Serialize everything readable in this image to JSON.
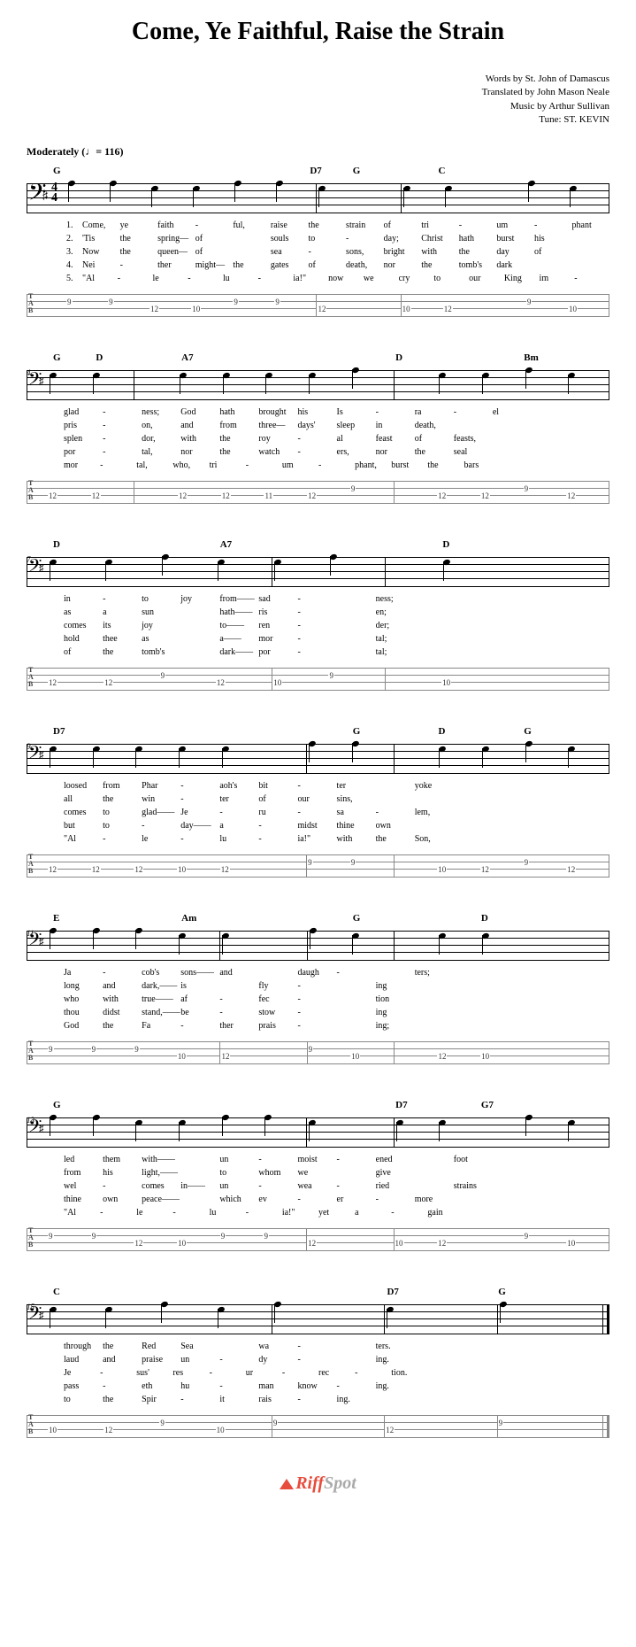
{
  "title": "Come, Ye Faithful, Raise the Strain",
  "credits": {
    "line1": "Words by St. John of Damascus",
    "line2": "Translated by John Mason Neale",
    "line3": "Music by Arthur Sullivan",
    "line4": "Tune: ST. KEVIN"
  },
  "tempo": "Moderately  (♩= 116)",
  "timesig_top": "4",
  "timesig_bot": "4",
  "clef": "𝄢",
  "sharp": "♯",
  "tab_label": "T\nA\nB",
  "watermark": {
    "a": "Riff",
    "b": "Spot"
  },
  "systems": [
    {
      "barnum": "",
      "first": true,
      "chords": [
        "G",
        "",
        "",
        "",
        "",
        "",
        "D7",
        "G",
        "",
        "C",
        "",
        "",
        ""
      ],
      "tab": [
        [
          "2",
          "9"
        ],
        [
          "2",
          "9"
        ],
        [
          "3",
          "12"
        ],
        [
          "3",
          "10"
        ],
        [
          "2",
          "9"
        ],
        [
          "2",
          "9"
        ],
        [
          "3",
          "12"
        ],
        [
          "",
          "B"
        ],
        [
          "3",
          "10"
        ],
        [
          "3",
          "12"
        ],
        [
          "",
          "B"
        ],
        [
          "2",
          "9"
        ],
        [
          "3",
          "10"
        ]
      ],
      "bars": [
        6,
        8,
        13
      ],
      "verses": [
        [
          "1.",
          "Come,",
          "ye",
          "faith",
          "-",
          "ful,",
          "raise",
          "the",
          "strain",
          "of",
          "tri",
          "-",
          "um",
          "-",
          "phant"
        ],
        [
          "2.",
          "'Tis",
          "the",
          "spring—",
          "of",
          "",
          "souls",
          "to",
          "-",
          "day;",
          "Christ",
          "hath",
          "burst",
          "his",
          ""
        ],
        [
          "3.",
          "Now",
          "the",
          "queen—",
          "of",
          "",
          "sea",
          "-",
          "sons,",
          "bright",
          "with",
          "the",
          "day",
          "of",
          ""
        ],
        [
          "4.",
          "Nei",
          "-",
          "ther",
          "might—",
          "the",
          "gates",
          "of",
          "death,",
          "nor",
          "the",
          "tomb's",
          "dark",
          "",
          ""
        ],
        [
          "5.",
          "\"Al",
          "-",
          "le",
          "-",
          "lu",
          "-",
          "ia!\"",
          "now",
          "we",
          "cry",
          "to",
          "our",
          "King",
          "im",
          "-"
        ]
      ]
    },
    {
      "barnum": "4",
      "chords": [
        "G",
        "D",
        "",
        "A7",
        "",
        "",
        "",
        "",
        "D",
        "",
        "",
        "Bm",
        ""
      ],
      "tab": [
        [
          "3",
          "12"
        ],
        [
          "3",
          "12"
        ],
        [
          "",
          "B"
        ],
        [
          "3",
          "12"
        ],
        [
          "3",
          "12"
        ],
        [
          "3",
          "11"
        ],
        [
          "3",
          "12"
        ],
        [
          "2",
          "9"
        ],
        [
          "",
          "B"
        ],
        [
          "3",
          "12"
        ],
        [
          "3",
          "12"
        ],
        [
          "2",
          "9"
        ],
        [
          "3",
          "12"
        ]
      ],
      "bars": [
        2,
        8,
        13
      ],
      "verses": [
        [
          "",
          "glad",
          "-",
          "ness;",
          "God",
          "hath",
          "brought",
          "his",
          "Is",
          "-",
          "ra",
          "-",
          "el",
          "",
          ""
        ],
        [
          "",
          "pris",
          "-",
          "on,",
          "and",
          "from",
          "three—",
          "days'",
          "sleep",
          "in",
          "death,",
          "",
          "",
          "",
          ""
        ],
        [
          "",
          "splen",
          "-",
          "dor,",
          "with",
          "the",
          "roy",
          "-",
          "al",
          "feast",
          "of",
          "feasts,",
          "",
          "",
          ""
        ],
        [
          "",
          "por",
          "-",
          "tal,",
          "nor",
          "the",
          "watch",
          "-",
          "ers,",
          "nor",
          "the",
          "seal",
          "",
          "",
          ""
        ],
        [
          "",
          "mor",
          "-",
          "tal,",
          "who,",
          "tri",
          "-",
          "um",
          "-",
          "phant,",
          "burst",
          "the",
          "bars",
          "",
          "",
          ""
        ]
      ]
    },
    {
      "barnum": "7",
      "chords": [
        "D",
        "",
        "",
        "A7",
        "",
        "",
        "",
        "D",
        "",
        ""
      ],
      "tab": [
        [
          "3",
          "12"
        ],
        [
          "3",
          "12"
        ],
        [
          "2",
          "9"
        ],
        [
          "3",
          "12"
        ],
        [
          "3",
          "10"
        ],
        [
          "2",
          "9"
        ],
        [
          "",
          "B"
        ],
        [
          "3",
          "10"
        ],
        [
          "",
          "B"
        ],
        [
          "",
          "B"
        ]
      ],
      "bars": [
        4,
        6,
        10
      ],
      "verses": [
        [
          "",
          "in",
          "-",
          "to",
          "joy",
          "from——",
          "sad",
          "-",
          "",
          "ness;",
          "",
          "",
          "",
          "",
          ""
        ],
        [
          "",
          "as",
          "a",
          "sun",
          "",
          "hath——",
          "ris",
          "-",
          "",
          "en;",
          "",
          "",
          "",
          "",
          ""
        ],
        [
          "",
          "comes",
          "its",
          "joy",
          "",
          "to——",
          "ren",
          "-",
          "",
          "der;",
          "",
          "",
          "",
          "",
          ""
        ],
        [
          "",
          "hold",
          "thee",
          "as",
          "",
          "a——",
          "mor",
          "-",
          "",
          "tal;",
          "",
          "",
          "",
          "",
          ""
        ],
        [
          "",
          "of",
          "the",
          "tomb's",
          "",
          "dark——",
          "por",
          "-",
          "",
          "tal;",
          "",
          "",
          "",
          "",
          ""
        ]
      ]
    },
    {
      "barnum": "9",
      "chords": [
        "D7",
        "",
        "",
        "",
        "",
        "",
        "",
        "G",
        "",
        "D",
        "",
        "G",
        ""
      ],
      "tab": [
        [
          "3",
          "12"
        ],
        [
          "3",
          "12"
        ],
        [
          "3",
          "12"
        ],
        [
          "3",
          "10"
        ],
        [
          "3",
          "12"
        ],
        [
          "",
          "B"
        ],
        [
          "2",
          "9"
        ],
        [
          "2",
          "9"
        ],
        [
          "",
          "B"
        ],
        [
          "3",
          "10"
        ],
        [
          "3",
          "12"
        ],
        [
          "2",
          "9"
        ],
        [
          "3",
          "12"
        ]
      ],
      "bars": [
        6,
        8,
        13
      ],
      "verses": [
        [
          "",
          "loosed",
          "from",
          "Phar",
          "-",
          "aoh's",
          "bit",
          "-",
          "ter",
          "",
          "yoke",
          "",
          "",
          "",
          ""
        ],
        [
          "",
          "all",
          "the",
          "win",
          "-",
          "ter",
          "of",
          "our",
          "sins,",
          "",
          "",
          "",
          "",
          "",
          ""
        ],
        [
          "",
          "comes",
          "to",
          "glad——",
          "Je",
          "-",
          "ru",
          "-",
          "sa",
          "-",
          "lem,",
          "",
          "",
          "",
          ""
        ],
        [
          "",
          "but",
          "to",
          "-",
          "day——",
          "a",
          "-",
          "midst",
          "thine",
          "own",
          "",
          "",
          "",
          "",
          ""
        ],
        [
          "",
          "\"Al",
          "-",
          "le",
          "-",
          "lu",
          "-",
          "ia!\"",
          "with",
          "the",
          "Son,",
          "",
          "",
          "",
          ""
        ]
      ]
    },
    {
      "barnum": "11",
      "chords": [
        "E",
        "",
        "",
        "Am",
        "",
        "",
        "",
        "G",
        "",
        "",
        "D",
        "",
        ""
      ],
      "tab": [
        [
          "2",
          "9"
        ],
        [
          "2",
          "9"
        ],
        [
          "2",
          "9"
        ],
        [
          "3",
          "10"
        ],
        [
          "3",
          "12"
        ],
        [
          "",
          "B"
        ],
        [
          "2",
          "9"
        ],
        [
          "3",
          "10"
        ],
        [
          "",
          "B"
        ],
        [
          "3",
          "12"
        ],
        [
          "3",
          "10"
        ],
        [
          "",
          "B"
        ],
        [
          "",
          "B"
        ]
      ],
      "bars": [
        4,
        6,
        8,
        13
      ],
      "verses": [
        [
          "",
          "Ja",
          "-",
          "cob's",
          "sons——",
          "and",
          "",
          "daugh",
          "-",
          "",
          "ters;",
          "",
          "",
          "",
          ""
        ],
        [
          "",
          "long",
          "and",
          "dark,——",
          "is",
          "",
          "fly",
          "-",
          "",
          "ing",
          "",
          "",
          "",
          "",
          ""
        ],
        [
          "",
          "who",
          "with",
          "true——",
          "af",
          "-",
          "fec",
          "-",
          "",
          "tion",
          "",
          "",
          "",
          "",
          ""
        ],
        [
          "",
          "thou",
          "didst",
          "stand,——",
          "be",
          "-",
          "stow",
          "-",
          "",
          "ing",
          "",
          "",
          "",
          "",
          ""
        ],
        [
          "",
          "God",
          "the",
          "Fa",
          "-",
          "ther",
          "prais",
          "-",
          "",
          "ing;",
          "",
          "",
          "",
          "",
          ""
        ]
      ]
    },
    {
      "barnum": "13",
      "chords": [
        "G",
        "",
        "",
        "",
        "",
        "",
        "",
        "",
        "D7",
        "",
        "G7",
        "",
        ""
      ],
      "tab": [
        [
          "2",
          "9"
        ],
        [
          "2",
          "9"
        ],
        [
          "3",
          "12"
        ],
        [
          "3",
          "10"
        ],
        [
          "2",
          "9"
        ],
        [
          "2",
          "9"
        ],
        [
          "3",
          "12"
        ],
        [
          "",
          "B"
        ],
        [
          "3",
          "10"
        ],
        [
          "3",
          "12"
        ],
        [
          "",
          "B"
        ],
        [
          "2",
          "9"
        ],
        [
          "3",
          "10"
        ]
      ],
      "bars": [
        6,
        8,
        13
      ],
      "verses": [
        [
          "",
          "led",
          "them",
          "with——",
          "",
          "un",
          "-",
          "moist",
          "-",
          "ened",
          "",
          "foot",
          "",
          "",
          ""
        ],
        [
          "",
          "from",
          "his",
          "light,——",
          "",
          "to",
          "whom",
          "we",
          "",
          "give",
          "",
          "",
          "",
          "",
          ""
        ],
        [
          "",
          "wel",
          "-",
          "comes",
          "in——",
          "un",
          "-",
          "wea",
          "-",
          "ried",
          "",
          "strains",
          "",
          "",
          ""
        ],
        [
          "",
          "thine",
          "own",
          "peace——",
          "",
          "which",
          "ev",
          "-",
          "er",
          "-",
          "more",
          "",
          "",
          "",
          ""
        ],
        [
          "",
          "\"Al",
          "-",
          "le",
          "-",
          "lu",
          "-",
          "ia!\"",
          "yet",
          "a",
          "-",
          "gain",
          "",
          "",
          "",
          ""
        ]
      ]
    },
    {
      "barnum": "15",
      "chords": [
        "C",
        "",
        "",
        "",
        "",
        "",
        "D7",
        "",
        "G",
        ""
      ],
      "tab": [
        [
          "3",
          "10"
        ],
        [
          "3",
          "12"
        ],
        [
          "2",
          "9"
        ],
        [
          "3",
          "10"
        ],
        [
          "2",
          "9"
        ],
        [
          "",
          "B"
        ],
        [
          "3",
          "12"
        ],
        [
          "",
          "B"
        ],
        [
          "2",
          "9"
        ],
        [
          "",
          "B"
        ]
      ],
      "bars": [
        4,
        6,
        8,
        10
      ],
      "endbar": true,
      "verses": [
        [
          "",
          "through",
          "the",
          "Red",
          "Sea",
          "",
          "wa",
          "-",
          "",
          "ters.",
          "",
          "",
          "",
          "",
          ""
        ],
        [
          "",
          "laud",
          "and",
          "praise",
          "un",
          "-",
          "dy",
          "-",
          "",
          "ing.",
          "",
          "",
          "",
          "",
          ""
        ],
        [
          "",
          "Je",
          "-",
          "sus'",
          "res",
          "-",
          "ur",
          "-",
          "rec",
          "-",
          "tion.",
          "",
          "",
          "",
          "",
          ""
        ],
        [
          "",
          "pass",
          "-",
          "eth",
          "hu",
          "-",
          "man",
          "know",
          "-",
          "ing.",
          "",
          "",
          "",
          "",
          ""
        ],
        [
          "",
          "to",
          "the",
          "Spir",
          "-",
          "it",
          "rais",
          "-",
          "ing.",
          "",
          "",
          "",
          "",
          "",
          ""
        ]
      ]
    }
  ]
}
